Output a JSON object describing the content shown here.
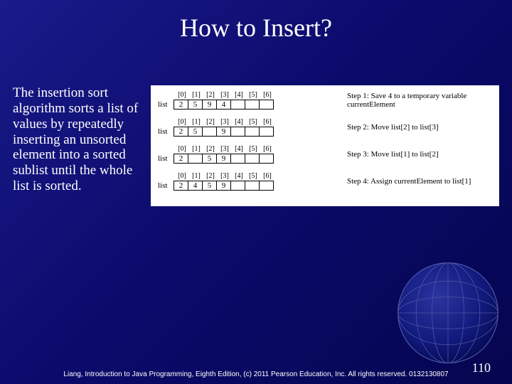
{
  "title": "How to Insert?",
  "description": "The insertion sort algorithm sorts a list of values by repeatedly inserting an unsorted element into a sorted sublist until the whole list is sorted.",
  "diagram": {
    "list_label": "list",
    "indices": [
      "[0]",
      "[1]",
      "[2]",
      "[3]",
      "[4]",
      "[5]",
      "[6]"
    ],
    "steps": [
      {
        "cells": [
          "2",
          "5",
          "9",
          "4",
          "",
          "",
          ""
        ],
        "text": "Step 1: Save 4 to a temporary variable currentElement"
      },
      {
        "cells": [
          "2",
          "5",
          "",
          "9",
          "",
          "",
          ""
        ],
        "text": "Step 2: Move list[2] to list[3]"
      },
      {
        "cells": [
          "2",
          "",
          "5",
          "9",
          "",
          "",
          ""
        ],
        "text": "Step 3: Move list[1] to list[2]"
      },
      {
        "cells": [
          "2",
          "4",
          "5",
          "9",
          "",
          "",
          ""
        ],
        "text": "Step 4: Assign currentElement to list[1]"
      }
    ]
  },
  "footer": "Liang, Introduction to Java Programming, Eighth Edition, (c) 2011 Pearson Education, Inc. All rights reserved. 0132130807",
  "page_number": "110"
}
